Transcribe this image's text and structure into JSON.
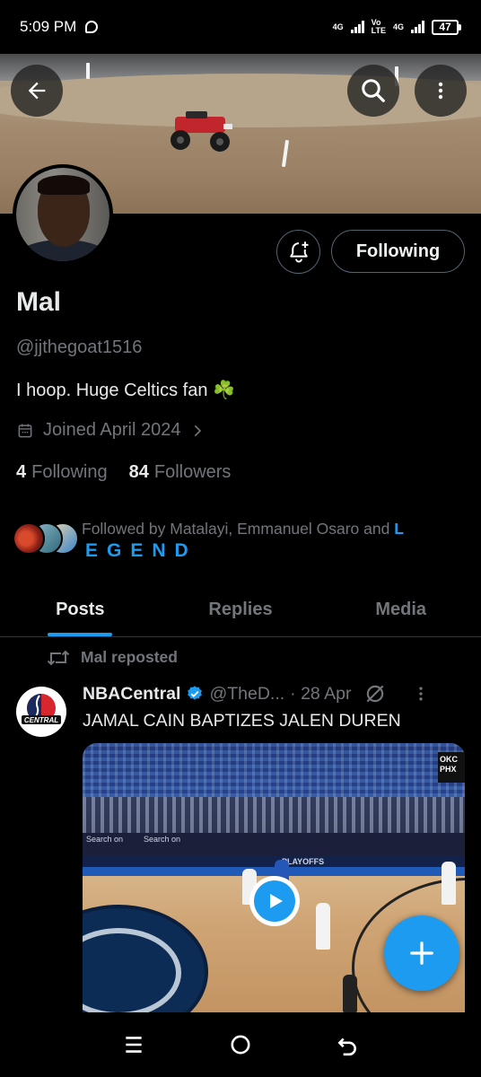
{
  "status_bar": {
    "time": "5:09 PM",
    "net1": "4G",
    "net2_top": "Vo",
    "net2_bottom": "LTE",
    "net3": "4G",
    "battery": "47"
  },
  "header": {
    "back_icon": "arrow-left-icon",
    "search_icon": "search-icon",
    "more_icon": "more-vertical-icon"
  },
  "profile": {
    "name": "Mal",
    "handle": "@jjthegoat1516",
    "bio": "I hoop. Huge Celtics fan ☘️",
    "joined": "Joined April 2024",
    "following_count": "4",
    "following_label": "Following",
    "followers_count": "84",
    "followers_label": "Followers",
    "following_button": "Following",
    "followed_by_text": "Followed by Matalayi, Emmanuel Osaro and",
    "followed_by_l": "L",
    "followed_by_rest": "EGEND"
  },
  "tabs": [
    {
      "label": "Posts",
      "active": true
    },
    {
      "label": "Replies",
      "active": false
    },
    {
      "label": "Media",
      "active": false
    }
  ],
  "post": {
    "repost_label": "Mal reposted",
    "author": "NBACentral",
    "handle": "@TheD...",
    "date": "· 28 Apr",
    "text": "JAMAL CAIN BAPTIZES JALEN DUREN",
    "avatar_text": "CENTRAL",
    "score_badge_top": "OKC",
    "score_badge_bottom": "PHX",
    "media_tag1": "Search on",
    "media_tag2": "PLAYOFFS"
  },
  "colors": {
    "accent": "#1d9bf0",
    "muted": "#71767b",
    "text": "#e7e9ea",
    "border": "#2f3336"
  }
}
